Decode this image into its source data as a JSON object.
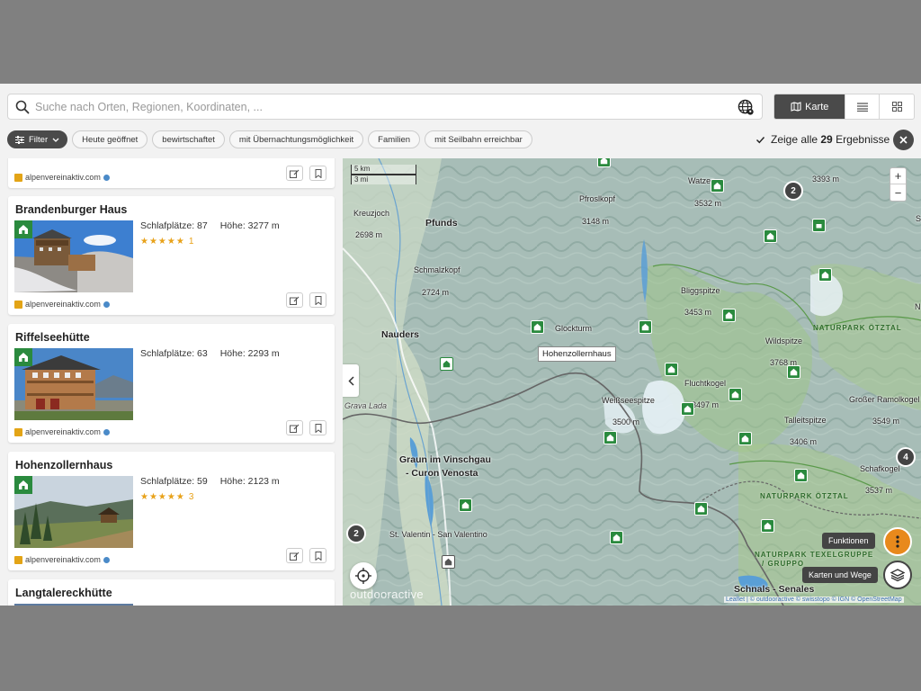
{
  "search": {
    "placeholder": "Suche nach Orten, Regionen, Koordinaten, ..."
  },
  "view": {
    "map_label": "Karte"
  },
  "filters": {
    "filter_button": "Filter",
    "chips": [
      "Heute geöffnet",
      "bewirtschaftet",
      "mit Übernachtungsmöglichkeit",
      "Familien",
      "mit Seilbahn erreichbar"
    ],
    "show_all_prefix": "Zeige alle",
    "show_all_count": "29",
    "show_all_suffix": "Ergebnisse"
  },
  "list": {
    "source": "alpenvereinaktiv.com",
    "cards": [
      {
        "title": "Brandenburger Haus",
        "beds": "Schlafplätze: 87",
        "height": "Höhe: 3277 m",
        "stars": "★★★★★",
        "rating_count": "1"
      },
      {
        "title": "Riffelseehütte",
        "beds": "Schlafplätze: 63",
        "height": "Höhe: 2293 m",
        "stars": "",
        "rating_count": ""
      },
      {
        "title": "Hohenzollernhaus",
        "beds": "Schlafplätze: 59",
        "height": "Höhe: 2123 m",
        "stars": "★★★★★",
        "rating_count": "3"
      },
      {
        "title": "Langtalereckhütte",
        "beds": "",
        "height": "",
        "stars": "",
        "rating_count": ""
      }
    ]
  },
  "map": {
    "scale_km": "5 km",
    "scale_mi": "3 mi",
    "tooltip": "Hohenzollernhaus",
    "watermark": "outdooractive",
    "attribution": "Leaflet | © outdooractive © swisstopo © IGN © OpenStreetMap",
    "zoom_in": "+",
    "zoom_out": "−",
    "functions_label": "Funktionen",
    "layers_label": "Karten und Wege",
    "labels": {
      "kreuzjoch": "Kreuzjoch",
      "kreuzjoch_h": "2698 m",
      "pfunds": "Pfunds",
      "pfroslkopf": "Pfroslkopf",
      "pfroslkopf_h": "3148 m",
      "watzes": "Watzes",
      "watzes_h": "3532 m",
      "top_h": "3393 m",
      "schmalzkopf": "Schmalzkopf",
      "schmalzkopf_h": "2724 m",
      "nauders": "Nauders",
      "glockturm": "Glockturm",
      "bliggspitze": "Bliggspitze",
      "bliggspitze_h": "3453 m",
      "wildspitze": "Wildspitze",
      "wildspitze_h": "3768 m",
      "naturpark_oetztal": "NATURPARK ÖTZTAL",
      "fluchtkogel": "Fluchtkogel",
      "fluchtkogel_h": "3497 m",
      "weissseespitze": "Weißseespitze",
      "weissseespitze_h": "3500 m",
      "grosser_ramolkogel": "Großer Ramolkogel",
      "grosser_ramolkogel_h": "3549 m",
      "grava_lada": "Grava Lada",
      "talleitspitze": "Talleitspitze",
      "talleitspitze_h": "3406 m",
      "graun": "Graun im Vinschgau",
      "curon": "- Curon Venosta",
      "schafkogel": "Schafkogel",
      "schafkogel_h": "3537 m",
      "naturpark_oetztal2": "NATURPARK ÖTZTAL",
      "st_valentin": "St. Valentin - San Valentino",
      "texelgruppe": "NATURPARK TEXELGRUPPE",
      "gruppo": "/ GRUPPO",
      "schnals": "Schnals - Senales",
      "edge_s": "S",
      "edge_n": "N"
    },
    "clusters": [
      "2",
      "4",
      "2"
    ]
  }
}
